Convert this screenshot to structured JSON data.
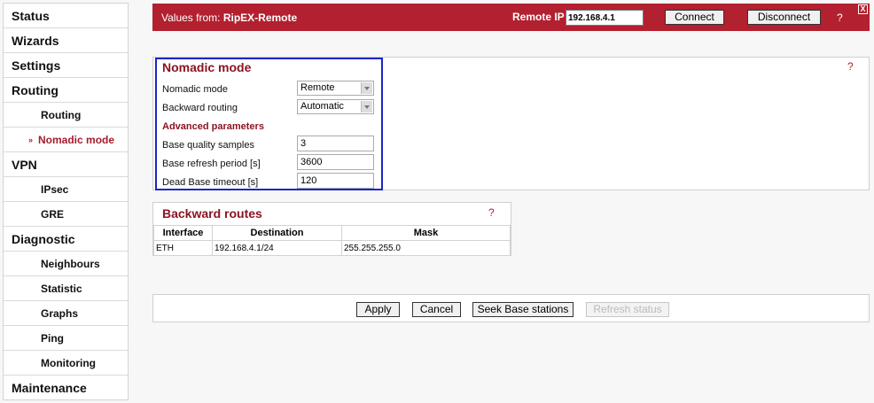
{
  "sidebar": {
    "items": [
      {
        "label": "Status"
      },
      {
        "label": "Wizards"
      },
      {
        "label": "Settings"
      },
      {
        "label": "Routing"
      },
      {
        "label": "Routing"
      },
      {
        "label": "Nomadic mode",
        "marker": "»"
      },
      {
        "label": "VPN"
      },
      {
        "label": "IPsec"
      },
      {
        "label": "GRE"
      },
      {
        "label": "Diagnostic"
      },
      {
        "label": "Neighbours"
      },
      {
        "label": "Statistic"
      },
      {
        "label": "Graphs"
      },
      {
        "label": "Ping"
      },
      {
        "label": "Monitoring"
      },
      {
        "label": "Maintenance"
      }
    ]
  },
  "header": {
    "values_prefix": "Values from: ",
    "values_device": "RipEX-Remote",
    "remote_ip_label": "Remote IP",
    "remote_ip_value": "192.168.4.1",
    "connect_label": "Connect",
    "disconnect_label": "Disconnect",
    "help": "?",
    "close": "X"
  },
  "nomadic": {
    "title": "Nomadic mode",
    "help": "?",
    "mode_label": "Nomadic mode",
    "mode_value": "Remote",
    "backward_label": "Backward routing",
    "backward_value": "Automatic",
    "advanced_label": "Advanced parameters",
    "samples_label": "Base quality samples",
    "samples_value": "3",
    "refresh_label": "Base refresh period [s]",
    "refresh_value": "3600",
    "timeout_label": "Dead Base timeout [s]",
    "timeout_value": "120"
  },
  "routes": {
    "title": "Backward routes",
    "help": "?",
    "columns": [
      "Interface",
      "Destination",
      "Mask"
    ],
    "rows": [
      {
        "interface": "ETH",
        "destination": "192.168.4.1/24",
        "mask": "255.255.255.0"
      }
    ]
  },
  "actions": {
    "apply": "Apply",
    "cancel": "Cancel",
    "seek": "Seek Base stations",
    "refresh": "Refresh status"
  },
  "colors": {
    "accent": "#b3202f",
    "title": "#8b1422",
    "highlight_box": "#1a26c8"
  }
}
